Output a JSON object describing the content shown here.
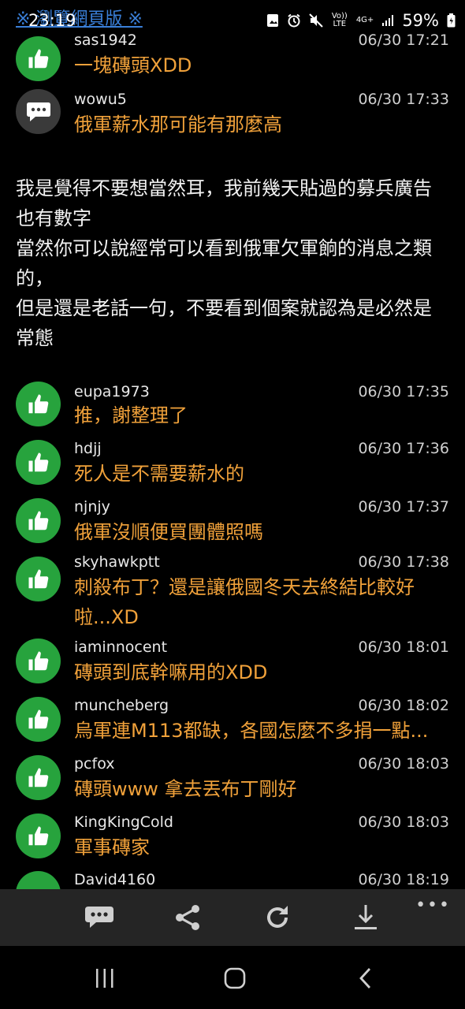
{
  "status_bar": {
    "browse_link": "※ 瀏覽網頁版 ※",
    "time": "23:19",
    "volte": "Vo)) LTE",
    "network": "4G+",
    "battery": "59%"
  },
  "comments_top": [
    {
      "user": "sas1942",
      "time": "06/30 17:21",
      "text": "一塊磚頭XDD",
      "icon": "thumbs-up-icon"
    },
    {
      "user": "wowu5",
      "time": "06/30 17:33",
      "text": "俄軍薪水那可能有那麼高",
      "icon": "chat-bubble-icon"
    }
  ],
  "body_lines": [
    "我是覺得不要想當然耳，我前幾天貼過的募兵廣告也有數字",
    "當然你可以說經常可以看到俄軍欠軍餉的消息之類的，",
    "但是還是老話一句，不要看到個案就認為是必然是常態"
  ],
  "comments": [
    {
      "user": "eupa1973",
      "time": "06/30 17:35",
      "text": "推，謝整理了"
    },
    {
      "user": "hdjj",
      "time": "06/30 17:36",
      "text": "死人是不需要薪水的"
    },
    {
      "user": "njnjy",
      "time": "06/30 17:37",
      "text": "俄軍沒順便買團體照嗎"
    },
    {
      "user": "skyhawkptt",
      "time": "06/30 17:38",
      "text": "刺殺布丁？還是讓俄國冬天去終結比較好啦...XD"
    },
    {
      "user": "iaminnocent",
      "time": "06/30 18:01",
      "text": "磚頭到底幹嘛用的XDD"
    },
    {
      "user": "muncheberg",
      "time": "06/30 18:02",
      "text": "烏軍連M113都缺，各國怎麼不多捐一點..."
    },
    {
      "user": "pcfox",
      "time": "06/30 18:03",
      "text": "磚頭www 拿去丟布丁剛好"
    },
    {
      "user": "KingKingCold",
      "time": "06/30 18:03",
      "text": "軍事磚家"
    },
    {
      "user": "David4160",
      "time": "06/30 18:19",
      "text": ""
    }
  ],
  "toolbar": {
    "items": [
      "comment-icon",
      "share-icon",
      "refresh-icon",
      "download-icon"
    ],
    "more": "•••"
  },
  "colors": {
    "like_green": "#27a33d",
    "push_text": "#f0a13a",
    "link_blue": "#3a7fd8",
    "toolbar_bg": "#252525"
  }
}
